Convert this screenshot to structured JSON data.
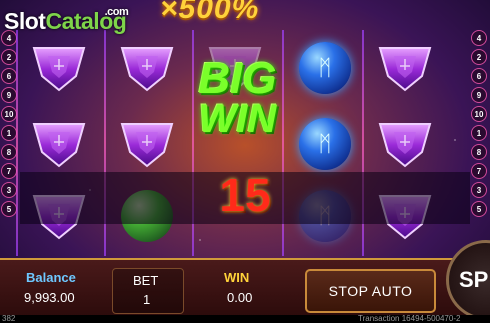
{
  "watermark": {
    "slot": "Slot",
    "catalog": "Catalog",
    "com": ".com"
  },
  "multiplier": "×500%",
  "big_win": {
    "line1": "BIG",
    "line2": "WIN"
  },
  "win_amount": "15",
  "paylines_left": [
    "4",
    "2",
    "6",
    "9",
    "10",
    "1",
    "8",
    "7",
    "3",
    "5"
  ],
  "paylines_right": [
    "4",
    "2",
    "6",
    "9",
    "10",
    "1",
    "8",
    "7",
    "3",
    "5"
  ],
  "reel_symbols": [
    [
      "purple-shield",
      "purple-shield",
      "purple-shield",
      "purple-shield"
    ],
    [
      "purple-shield",
      "purple-shield",
      "green-orb"
    ],
    [
      "shield",
      "big-win",
      "none"
    ],
    [
      "blue-orb",
      "blue-orb",
      "blue-orb-dim"
    ],
    [
      "purple-shield",
      "purple-shield",
      "purple-shield"
    ]
  ],
  "bottom": {
    "balance_label": "Balance",
    "balance_value": "9,993.00",
    "bet_label": "BET",
    "bet_value": "1",
    "win_label": "WIN",
    "win_value": "0.00",
    "stop_auto": "STOP AUTO",
    "spin": "SP"
  },
  "footer": {
    "left": "382",
    "right": "Transaction 16494-500470-2"
  },
  "colors": {
    "accent_gold": "#ffd23a",
    "win_green": "#7aff2a",
    "win_red": "#ff2a1a",
    "label_blue": "#6ec8ff"
  }
}
